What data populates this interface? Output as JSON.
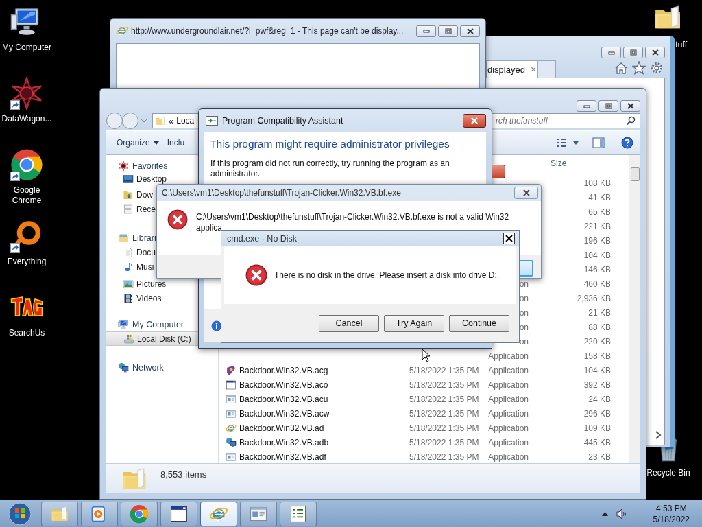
{
  "desktop_icons": [
    {
      "label": "My Computer",
      "kind": "computer",
      "shortcut": false
    },
    {
      "label": "DataWagon...",
      "kind": "star",
      "shortcut": true
    },
    {
      "label": "Google Chrome",
      "kind": "chrome",
      "shortcut": true
    },
    {
      "label": "Everything",
      "kind": "ring",
      "shortcut": true
    },
    {
      "label": "SearchUs",
      "kind": "logo",
      "shortcut": false
    }
  ],
  "right_icons": [
    {
      "label": "tuff",
      "kind": "folder",
      "shortcut": false
    },
    {
      "label": "Recycle Bin",
      "kind": "bin",
      "shortcut": false
    }
  ],
  "browser_back": {
    "tab": "displayed",
    "tab_close": "×"
  },
  "browser_popup": {
    "title": "http://www.undergroundlair.net/?l=pwf&reg=1 - This page can't be display..."
  },
  "explorer": {
    "address_chevron": "«",
    "address": "Loca",
    "search_placeholder": "rch thefunstuff",
    "toolbar": [
      {
        "label": "Organize",
        "dropdown": true
      },
      {
        "label": "Inclu",
        "dropdown": false
      }
    ],
    "nav": [
      {
        "label": "Favorites",
        "kind": "star",
        "selected": false,
        "children": [
          {
            "label": "Desktop",
            "kind": "desktop",
            "selected": false
          },
          {
            "label": "Dow",
            "kind": "downloads",
            "selected": false
          },
          {
            "label": "Rece",
            "kind": "recent",
            "selected": false
          }
        ]
      },
      {
        "label": "Librari",
        "kind": "library",
        "selected": false,
        "children": [
          {
            "label": "Docu",
            "kind": "document",
            "selected": false
          },
          {
            "label": "Musi",
            "kind": "music",
            "selected": false
          },
          {
            "label": "Pictures",
            "kind": "pictures",
            "selected": false
          },
          {
            "label": "Videos",
            "kind": "film",
            "selected": false
          }
        ]
      },
      {
        "label": "My Computer",
        "kind": "computer",
        "selected": false,
        "children": [
          {
            "label": "Local Disk (C:)",
            "kind": "drive",
            "selected": true
          }
        ]
      },
      {
        "label": "Network",
        "kind": "network",
        "selected": false
      }
    ],
    "size_header": "Size",
    "rows": [
      {
        "size": "108 KB"
      },
      {
        "size": "41 KB"
      },
      {
        "size": "65 KB"
      },
      {
        "size": "221 KB"
      },
      {
        "size": "196 KB"
      },
      {
        "size": "104 KB"
      },
      {
        "size": "146 KB"
      },
      {
        "type": "on",
        "size": "460 KB"
      },
      {
        "type": "on",
        "size": "2,936 KB"
      },
      {
        "type": "on",
        "size": "21 KB"
      },
      {
        "type": "on",
        "size": "88 KB"
      },
      {
        "type": "on",
        "size": "220 KB"
      },
      {
        "type": "Application",
        "size": "158 KB"
      },
      {
        "kind": "book",
        "name": "Backdoor.Win32.VB.acg",
        "date": "5/18/2022 1:35 PM",
        "type": "Application",
        "size": "104 KB"
      },
      {
        "kind": "window",
        "name": "Backdoor.Win32.VB.aco",
        "date": "5/18/2022 1:35 PM",
        "type": "Application",
        "size": "392 KB"
      },
      {
        "kind": "app",
        "name": "Backdoor.Win32.VB.acu",
        "date": "5/18/2022 1:35 PM",
        "type": "Application",
        "size": "24 KB"
      },
      {
        "kind": "app",
        "name": "Backdoor.Win32.VB.acw",
        "date": "5/18/2022 1:35 PM",
        "type": "Application",
        "size": "296 KB"
      },
      {
        "kind": "globe",
        "name": "Backdoor.Win32.VB.ad",
        "date": "5/18/2022 1:35 PM",
        "type": "Application",
        "size": "109 KB"
      },
      {
        "kind": "network",
        "name": "Backdoor.Win32.VB.adb",
        "date": "5/18/2022 1:35 PM",
        "type": "Application",
        "size": "445 KB"
      },
      {
        "kind": "app",
        "name": "Backdoor.Win32.VB.adf",
        "date": "5/18/2022 1:35 PM",
        "type": "Application",
        "size": "23 KB"
      }
    ],
    "status": "8,553 items"
  },
  "compat_dialog": {
    "title": "Program Compatibility Assistant",
    "heading": "This program might require administrator privileges",
    "body": "If this program did not run correctly, try running the program as an administrator."
  },
  "error_dialog": {
    "title": "C:\\Users\\vm1\\Desktop\\thefunstuff\\Trojan-Clicker.Win32.VB.bf.exe",
    "message_lines": [
      "C:\\Users\\vm1\\Desktop\\thefunstuff\\Trojan-Clicker.Win32.VB.bf.exe is not a valid Win32",
      "applica"
    ]
  },
  "disk_dialog": {
    "title": "cmd.exe - No Disk",
    "message": "There is no disk in the drive. Please insert a disk into drive D:.",
    "buttons": [
      "Cancel",
      "Try Again",
      "Continue"
    ]
  },
  "taskbar": {
    "buttons": [
      {
        "kind": "folder",
        "active": false
      },
      {
        "kind": "play",
        "active": false
      },
      {
        "kind": "chrome",
        "active": false
      },
      {
        "kind": "window",
        "active": false
      },
      {
        "kind": "globe",
        "active": true
      },
      {
        "kind": "app",
        "active": false
      },
      {
        "kind": "list",
        "active": false
      }
    ],
    "time": "4:53 PM",
    "date": "5/18/2022"
  }
}
